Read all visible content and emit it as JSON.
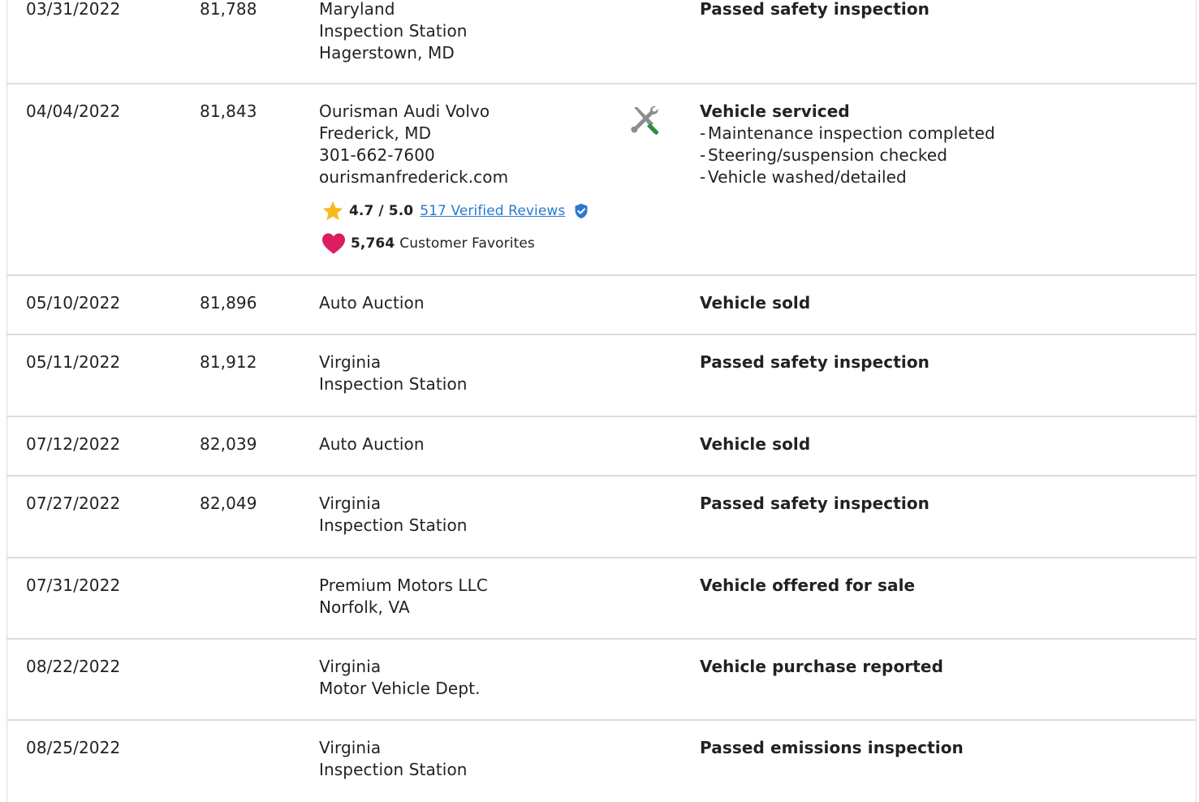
{
  "colors": {
    "row_border": "#dcdcdc",
    "link": "#2a79d0",
    "star": "#f5b921",
    "heart": "#dc1d64",
    "shield": "#2a79d0",
    "wrench_handle": "#2e8b3c",
    "tools_gray": "#8c8c8c"
  },
  "rows": [
    {
      "date": "03/31/2022",
      "odometer": "81,788",
      "source": [
        "Maryland",
        "Inspection Station",
        "Hagerstown, MD"
      ],
      "detail_title": "Passed safety inspection"
    },
    {
      "date": "04/04/2022",
      "odometer": "81,843",
      "source": [
        "Ourisman Audi Volvo",
        "Frederick, MD",
        "301-662-7600",
        "ourismanfrederick.com"
      ],
      "rating": {
        "score": "4.7 / 5.0",
        "reviews_link": "517 Verified Reviews",
        "star_icon": "star-icon",
        "verified_icon": "verified-shield-icon"
      },
      "favorites": {
        "count": "5,764",
        "label": "Customer Favorites",
        "heart_icon": "heart-icon"
      },
      "icon": "service-tools-icon",
      "detail_title": "Vehicle serviced",
      "detail_items": [
        "Maintenance inspection completed",
        "Steering/suspension checked",
        "Vehicle washed/detailed"
      ]
    },
    {
      "date": "05/10/2022",
      "odometer": "81,896",
      "source": [
        "Auto Auction"
      ],
      "detail_title": "Vehicle sold"
    },
    {
      "date": "05/11/2022",
      "odometer": "81,912",
      "source": [
        "Virginia",
        "Inspection Station"
      ],
      "detail_title": "Passed safety inspection"
    },
    {
      "date": "07/12/2022",
      "odometer": "82,039",
      "source": [
        "Auto Auction"
      ],
      "detail_title": "Vehicle sold"
    },
    {
      "date": "07/27/2022",
      "odometer": "82,049",
      "source": [
        "Virginia",
        "Inspection Station"
      ],
      "detail_title": "Passed safety inspection"
    },
    {
      "date": "07/31/2022",
      "odometer": "",
      "source": [
        "Premium Motors LLC",
        "Norfolk, VA"
      ],
      "detail_title": "Vehicle offered for sale"
    },
    {
      "date": "08/22/2022",
      "odometer": "",
      "source": [
        "Virginia",
        "Motor Vehicle Dept."
      ],
      "detail_title": "Vehicle purchase reported"
    },
    {
      "date": "08/25/2022",
      "odometer": "",
      "source": [
        "Virginia",
        "Inspection Station"
      ],
      "detail_title": "Passed emissions inspection"
    }
  ]
}
